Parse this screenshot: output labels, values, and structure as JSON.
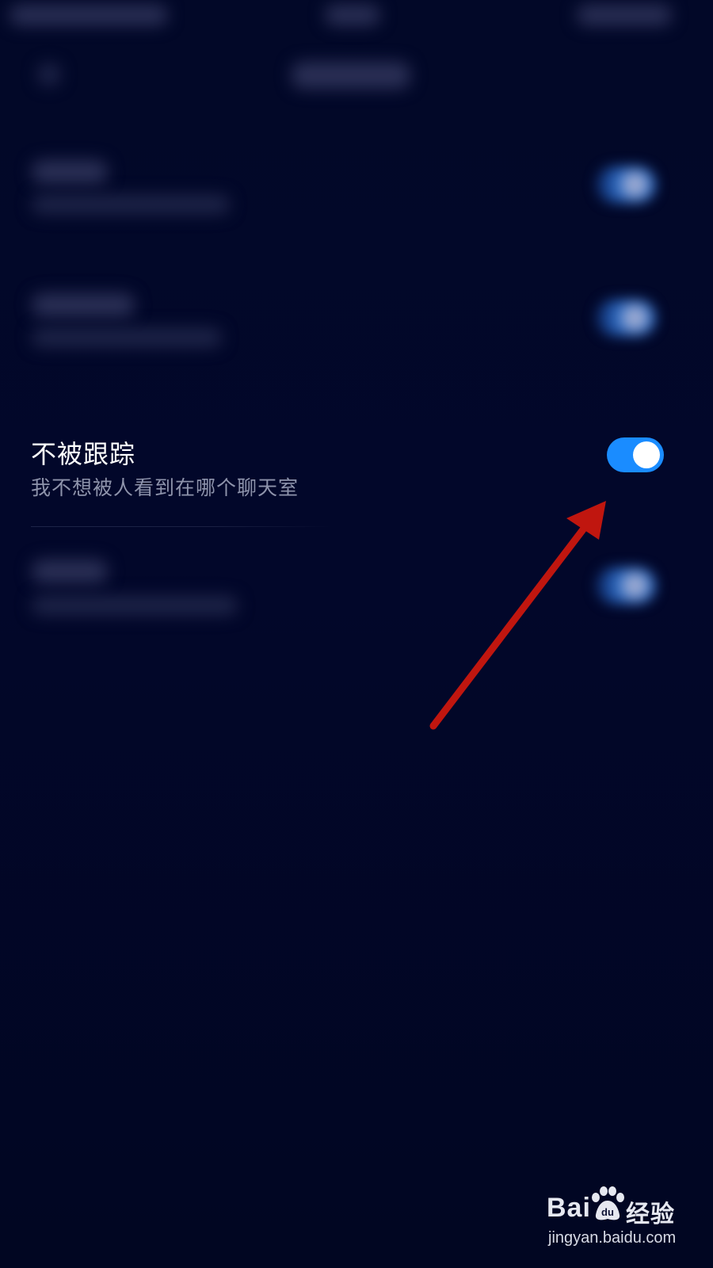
{
  "setting": {
    "title": "不被跟踪",
    "description": "我不想被人看到在哪个聊天室",
    "enabled": true,
    "accent_color": "#1a8cff"
  },
  "watermark": {
    "logo_text": "Bai",
    "logo_text_suffix": "经验",
    "url": "jingyan.baidu.com"
  },
  "annotation": {
    "arrow_color": "#c0160f"
  },
  "icons": {
    "watermark_paw": "paw-icon",
    "annotation_arrow": "arrow-icon"
  }
}
